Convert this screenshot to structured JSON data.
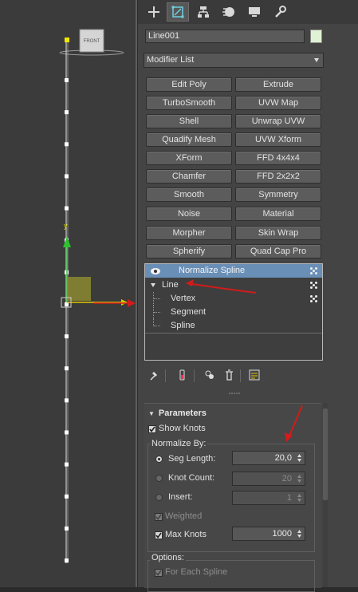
{
  "viewport": {
    "viewcube_label": "FRONT",
    "axis_label_y": "y",
    "knot_count": 16
  },
  "panel": {
    "tabs": [
      {
        "icon": "plus-icon",
        "label": "Create"
      },
      {
        "icon": "modify-icon",
        "label": "Modify"
      },
      {
        "icon": "hierarchy-icon",
        "label": "Hierarchy"
      },
      {
        "icon": "motion-icon",
        "label": "Motion"
      },
      {
        "icon": "display-icon",
        "label": "Display"
      },
      {
        "icon": "utilities-icon",
        "label": "Utilities"
      }
    ],
    "object_name": "Line001",
    "object_color": "#dff2d4",
    "modifier_list_label": "Modifier List",
    "modifier_buttons": [
      "Edit Poly",
      "Extrude",
      "TurboSmooth",
      "UVW Map",
      "Shell",
      "Unwrap UVW",
      "Quadify Mesh",
      "UVW Xform",
      "XForm",
      "FFD 4x4x4",
      "Chamfer",
      "FFD 2x2x2",
      "Smooth",
      "Symmetry",
      "Noise",
      "Material",
      "Morpher",
      "Skin Wrap",
      "Spherify",
      "Quad Cap Pro"
    ],
    "stack": {
      "modifier": "Normalize Spline",
      "base": "Line",
      "sub_levels": [
        "Vertex",
        "Segment",
        "Spline"
      ]
    },
    "parameters": {
      "title": "Parameters",
      "show_knots_label": "Show Knots",
      "normalize_by_label": "Normalize By:",
      "seg_length_label": "Seg Length:",
      "seg_length_value": "20,0",
      "knot_count_label": "Knot Count:",
      "knot_count_value": "20",
      "insert_label": "Insert:",
      "insert_value": "1",
      "weighted_label": "Weighted",
      "max_knots_label": "Max Knots",
      "max_knots_value": "1000",
      "options_label": "Options:",
      "for_each_spline_label": "For Each Spline"
    }
  }
}
